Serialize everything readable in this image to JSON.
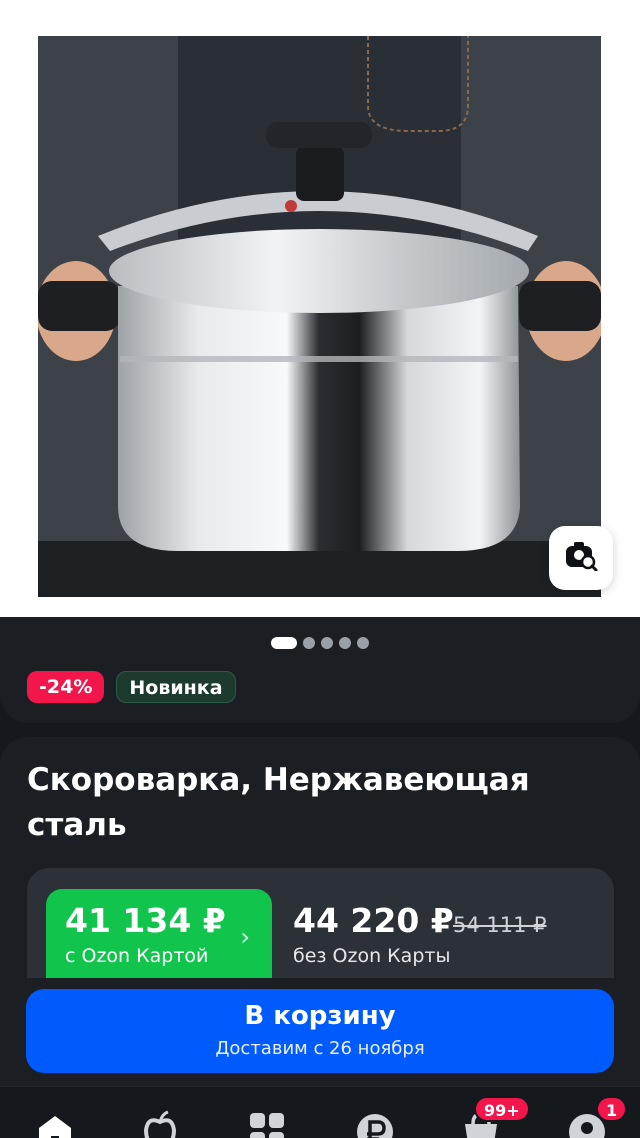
{
  "product": {
    "images_count": 5,
    "active_image": 1,
    "badges": {
      "discount": "-24%",
      "new": "Новинка"
    },
    "title": "Скороварка, Нержавеющая сталь"
  },
  "price": {
    "ozon_card_price": "41 134 ₽",
    "ozon_card_label": "с Ozon Картой",
    "regular_price": "44 220 ₽",
    "old_price": "54 111 ₽",
    "regular_label": "без Ozon Карты"
  },
  "cart_button": {
    "label": "В корзину",
    "delivery": "Доставим с 26 ноября"
  },
  "bottom_nav": {
    "cart_badge": "99+",
    "profile_badge": "1"
  },
  "colors": {
    "accent_blue": "#005bff",
    "ozon_green": "#10c44c",
    "discount_red": "#f2164b",
    "background": "#15181d"
  },
  "icons": {
    "visual_search": "camera-search-icon",
    "chevron": "chevron-right-icon"
  }
}
